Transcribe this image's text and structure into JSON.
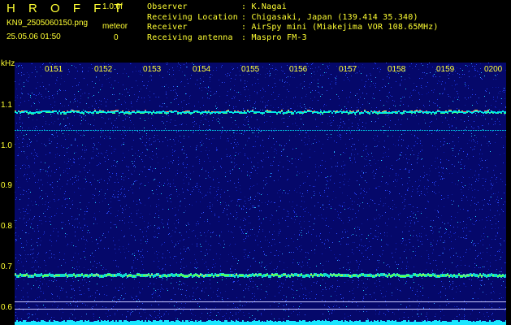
{
  "header": {
    "app_title": "H R O F F T",
    "version": "1.0.0f",
    "filename": "KN9_2505060150.png",
    "meteor_label": "meteor",
    "timestamp": "25.05.06 01:50",
    "meteor_count": "0"
  },
  "info": [
    {
      "key": "Observer",
      "value": ": K.Nagai"
    },
    {
      "key": "Receiving Location",
      "value": ": Chigasaki, Japan (139.414 35.340)"
    },
    {
      "key": "Receiver",
      "value": ": AirSpy mini (Miakejima VOR 108.65MHz)"
    },
    {
      "key": "Receiving antenna",
      "value": ": Maspro FM-3"
    }
  ],
  "axis": {
    "y_unit": "kHz",
    "x_ticks": [
      "0151",
      "0152",
      "0153",
      "0154",
      "0155",
      "0156",
      "0157",
      "0158",
      "0159",
      "0200"
    ],
    "y_ticks": [
      "1.1",
      "1.0",
      "0.9",
      "0.8",
      "0.7",
      "0.6"
    ]
  },
  "colors": {
    "background": "#000000",
    "text": "#ffff33",
    "spectrogram_base": "#05086a"
  }
}
